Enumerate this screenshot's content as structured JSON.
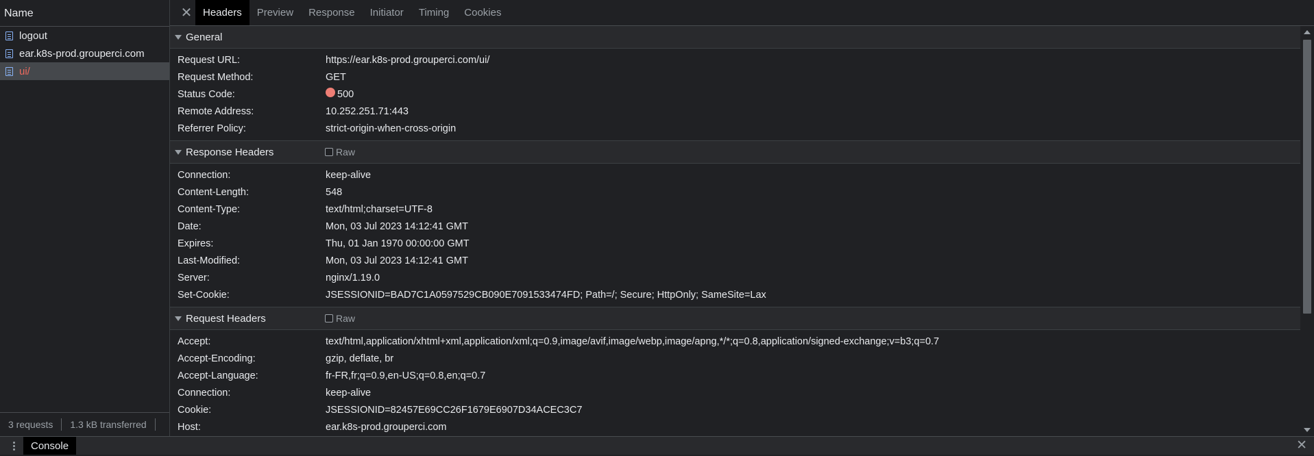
{
  "request_list": {
    "header": "Name",
    "items": [
      {
        "label": "logout"
      },
      {
        "label": "ear.k8s-prod.grouperci.com"
      },
      {
        "label": "ui/"
      }
    ],
    "footer": {
      "requests": "3 requests",
      "transferred": "1.3 kB transferred"
    }
  },
  "tabs": [
    "Headers",
    "Preview",
    "Response",
    "Initiator",
    "Timing",
    "Cookies"
  ],
  "general": {
    "title": "General",
    "rows": [
      {
        "key": "Request URL:",
        "value": "https://ear.k8s-prod.grouperci.com/ui/"
      },
      {
        "key": "Request Method:",
        "value": "GET"
      },
      {
        "key": "Status Code:",
        "value": "500"
      },
      {
        "key": "Remote Address:",
        "value": "10.252.251.71:443"
      },
      {
        "key": "Referrer Policy:",
        "value": "strict-origin-when-cross-origin"
      }
    ]
  },
  "response_headers": {
    "title": "Response Headers",
    "raw_label": "Raw",
    "rows": [
      {
        "key": "Connection:",
        "value": "keep-alive"
      },
      {
        "key": "Content-Length:",
        "value": "548"
      },
      {
        "key": "Content-Type:",
        "value": "text/html;charset=UTF-8"
      },
      {
        "key": "Date:",
        "value": "Mon, 03 Jul 2023 14:12:41 GMT"
      },
      {
        "key": "Expires:",
        "value": "Thu, 01 Jan 1970 00:00:00 GMT"
      },
      {
        "key": "Last-Modified:",
        "value": "Mon, 03 Jul 2023 14:12:41 GMT"
      },
      {
        "key": "Server:",
        "value": "nginx/1.19.0"
      },
      {
        "key": "Set-Cookie:",
        "value": "JSESSIONID=BAD7C1A0597529CB090E7091533474FD; Path=/; Secure; HttpOnly; SameSite=Lax"
      }
    ]
  },
  "request_headers": {
    "title": "Request Headers",
    "raw_label": "Raw",
    "rows": [
      {
        "key": "Accept:",
        "value": "text/html,application/xhtml+xml,application/xml;q=0.9,image/avif,image/webp,image/apng,*/*;q=0.8,application/signed-exchange;v=b3;q=0.7"
      },
      {
        "key": "Accept-Encoding:",
        "value": "gzip, deflate, br"
      },
      {
        "key": "Accept-Language:",
        "value": "fr-FR,fr;q=0.9,en-US;q=0.8,en;q=0.7"
      },
      {
        "key": "Connection:",
        "value": "keep-alive"
      },
      {
        "key": "Cookie:",
        "value": "JSESSIONID=82457E69CC26F1679E6907D34ACEC3C7"
      },
      {
        "key": "Host:",
        "value": "ear.k8s-prod.grouperci.com"
      }
    ]
  },
  "drawer": {
    "console_tab": "Console"
  },
  "colors": {
    "error": "#ee6a5e",
    "status_dot": "#ee7e75",
    "selected_row": "#45484c"
  }
}
